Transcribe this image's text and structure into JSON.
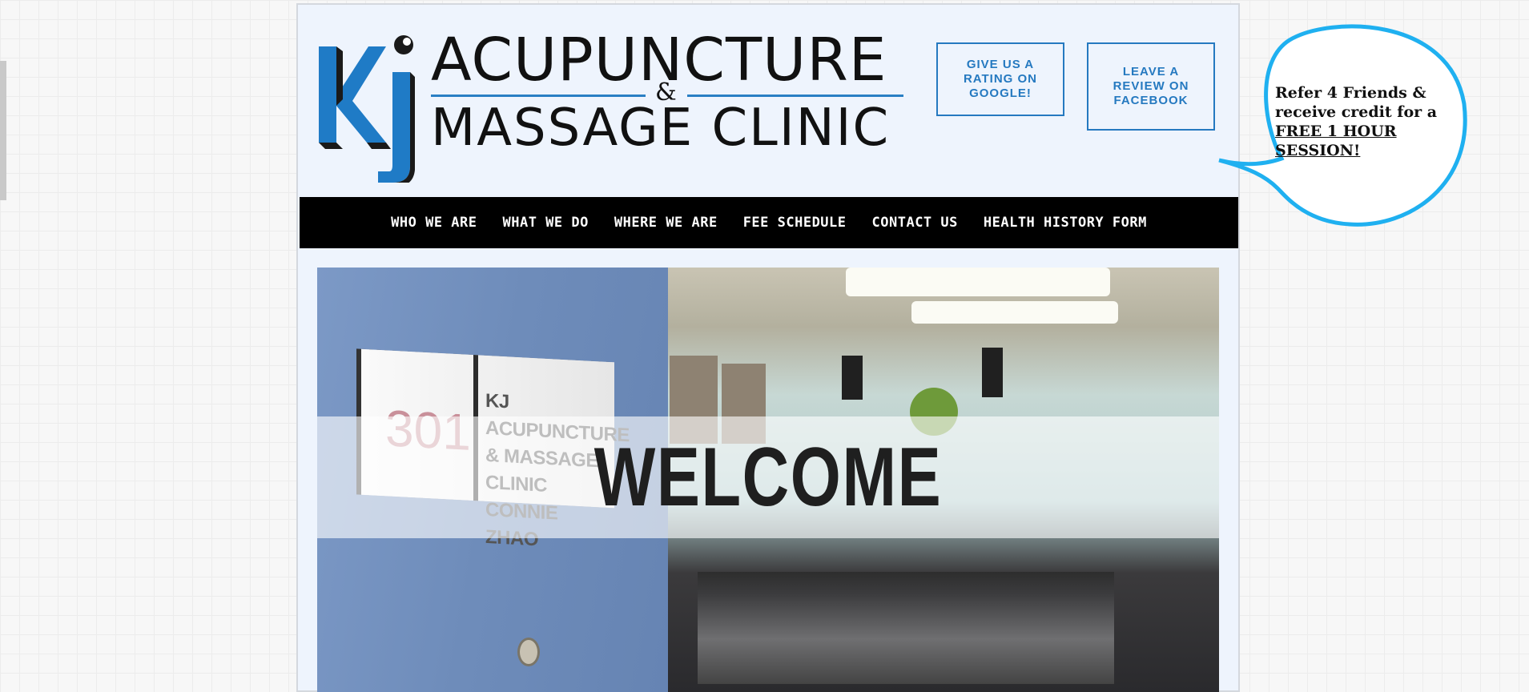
{
  "logo": {
    "monogram": "KJ",
    "title": "ACUPUNCTURE",
    "ampersand": "&",
    "subtitle": "MASSAGE  CLINIC",
    "accent_color": "#2a7fc4"
  },
  "cta": {
    "google_label": "GIVE US A RATING ON GOOGLE!",
    "facebook_label": "LEAVE A REVIEW ON FACEBOOK",
    "color": "#2579c0"
  },
  "promo": {
    "line1": "Refer 4 Friends & receive credit for a ",
    "highlight": "FREE 1 HOUR SESSION!",
    "bubble_color": "#1fb0f0"
  },
  "nav": {
    "items": [
      "WHO WE ARE",
      "WHAT WE DO",
      "WHERE WE ARE",
      "FEE SCHEDULE",
      "CONTACT US",
      "HEALTH HISTORY FORM"
    ]
  },
  "hero": {
    "welcome": "WELCOME",
    "sign_number": "301",
    "sign_text": "KJ ACUPUNCTURE & MASSAGE CLINIC CONNIE ZHAO"
  }
}
